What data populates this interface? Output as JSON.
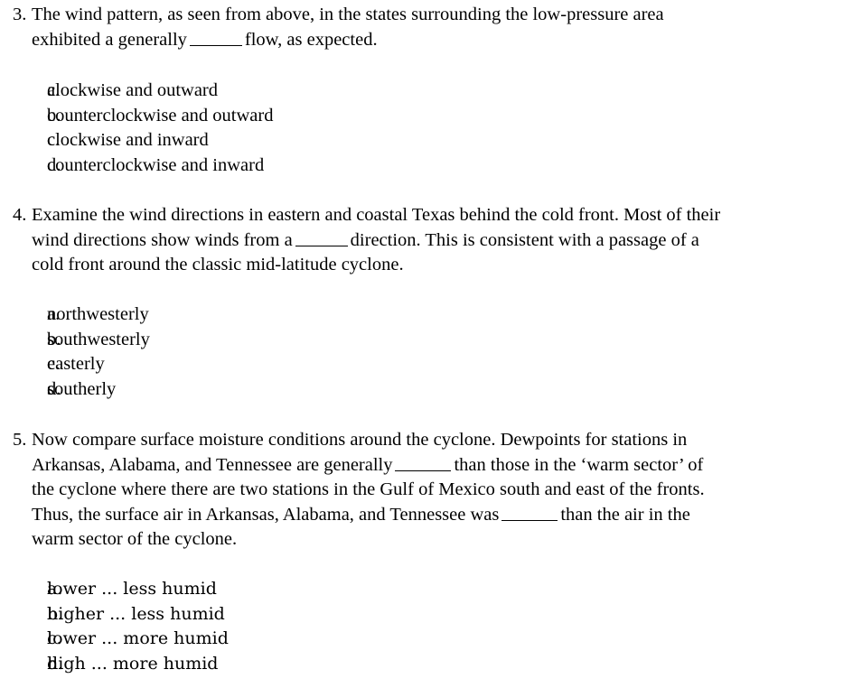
{
  "document": {
    "type": "multiple-choice-quiz",
    "background_color": "#ffffff",
    "text_color": "#000000"
  },
  "questions": [
    {
      "number": "3.",
      "lines": [
        "The wind pattern, as seen from above, in the states surrounding the low-pressure area",
        "exhibited a generally ____ flow, as expected."
      ],
      "line1_part1": "The wind pattern, as seen from above, in the states surrounding the low-pressure area",
      "line2_part1": "exhibited a generally",
      "line2_part2": "flow, as expected.",
      "options": [
        {
          "letter": "a.",
          "text": "clockwise and outward"
        },
        {
          "letter": "b.",
          "text": "counterclockwise and outward"
        },
        {
          "letter": "c.",
          "text": "clockwise and inward"
        },
        {
          "letter": "d.",
          "text": "counterclockwise and inward"
        }
      ]
    },
    {
      "number": "4.",
      "line1_part1": "Examine the wind directions in eastern and coastal Texas behind the cold front. Most of their",
      "line2_part1": "wind directions show winds from a",
      "line2_part2": "direction. This is consistent with a passage of a",
      "line3_part1": "cold front around the classic mid-latitude cyclone.",
      "options": [
        {
          "letter": "a.",
          "text": "northwesterly"
        },
        {
          "letter": "b.",
          "text": "southwesterly"
        },
        {
          "letter": "c.",
          "text": "easterly"
        },
        {
          "letter": "d.",
          "text": "southerly"
        }
      ]
    },
    {
      "number": "5.",
      "line1_part1": "Now compare surface moisture conditions around the cyclone. Dewpoints for stations in",
      "line2_part1": "Arkansas, Alabama, and Tennessee are generally",
      "line2_part2": "than those in the ‘warm sector’ of",
      "line3_part1": "the cyclone where there are two stations in the Gulf of Mexico south and east of the fronts.",
      "line4_part1": "Thus, the surface air in Arkansas, Alabama, and Tennessee was",
      "line4_part2": "than the air in the",
      "line5_part1": "warm sector of the cyclone.",
      "options": [
        {
          "letter": "a.",
          "text": "lower ... less humid"
        },
        {
          "letter": "b.",
          "text": "higher ... less humid"
        },
        {
          "letter": "c.",
          "text": "lower ... more humid"
        },
        {
          "letter": "d.",
          "text": "high ... more humid"
        }
      ]
    }
  ]
}
